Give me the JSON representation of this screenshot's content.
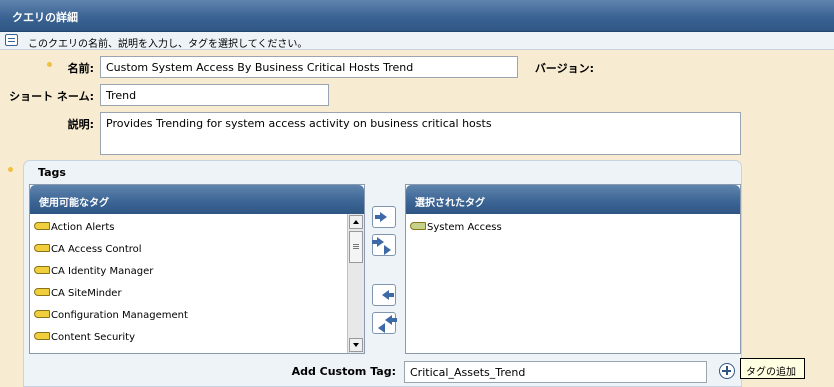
{
  "header": {
    "title": "クエリの詳細"
  },
  "info": {
    "text": "このクエリの名前、説明を入力し、タグを選択してください。"
  },
  "form": {
    "name_label": "名前:",
    "name_value": "Custom System Access By Business Critical Hosts Trend",
    "version_label": "バージョン:",
    "shortname_label": "ショート ネーム:",
    "shortname_value": "Trend",
    "description_label": "説明:",
    "description_value": "Provides Trending for system access activity on business critical hosts"
  },
  "tags": {
    "title": "Tags",
    "available_header": "使用可能なタグ",
    "available": [
      "Action Alerts",
      "CA Access Control",
      "CA Identity Manager",
      "CA SiteMinder",
      "Configuration Management",
      "Content Security"
    ],
    "selected_header": "選択されたタグ",
    "selected": [
      "System Access"
    ],
    "custom_label": "Add Custom Tag:",
    "custom_value": "Critical_Assets_Trend",
    "add_tooltip": "タグの追加"
  },
  "colors": {
    "titlebar": "#3b6494",
    "page_bg": "#f7ebd2",
    "required": "#f0c040",
    "tag": "#f1cf3c"
  },
  "icons": [
    "info-icon",
    "tag-icon",
    "move-right-icon",
    "move-all-right-icon",
    "move-left-icon",
    "move-all-left-icon",
    "add-icon"
  ]
}
